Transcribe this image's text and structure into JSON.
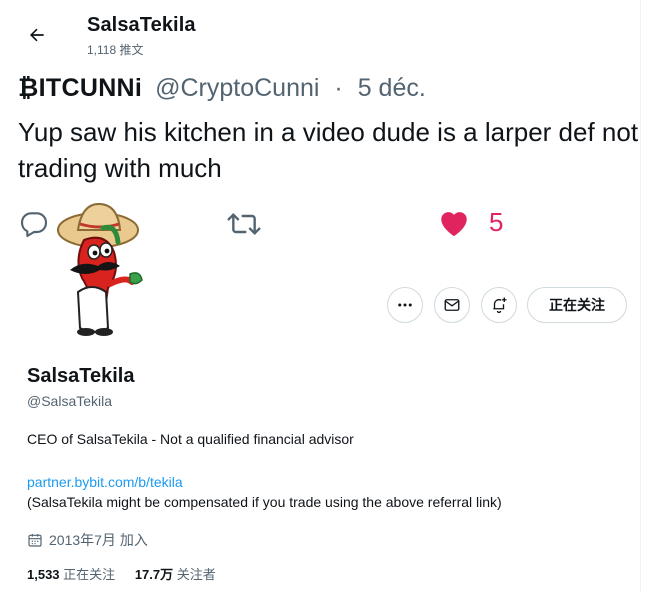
{
  "header": {
    "title": "SalsaTekila",
    "subtitle": "1,118 推文"
  },
  "tweet": {
    "author": "₿ITCUNNi",
    "handle": "@CryptoCunni",
    "separator": "·",
    "date": "5 déc.",
    "text": "Yup saw his kitchen in a video dude is a larper def not trading with much",
    "likes": "5"
  },
  "profile": {
    "name": "SalsaTekila",
    "handle": "@SalsaTekila",
    "bio": "CEO of SalsaTekila - Not a qualified financial advisor",
    "link": "partner.bybit.com/b/tekila",
    "note": "(SalsaTekila might be compensated if you trade using the above referral link)",
    "joined": "2013年7月 加入",
    "following_count": "1,533",
    "following_label": "正在关注",
    "followers_count": "17.7万",
    "followers_label": "关注者",
    "follow_button": "正在关注"
  },
  "icons": {
    "back": "arrow-left-icon",
    "reply": "reply-icon",
    "retweet": "retweet-icon",
    "like": "heart-icon",
    "more": "more-icon",
    "message": "envelope-icon",
    "notify": "bell-plus-icon",
    "calendar": "calendar-icon"
  },
  "colors": {
    "like": "#e0245e",
    "link": "#1d9bf0",
    "muted": "#536471",
    "text": "#0f1419",
    "border": "#cfd9de"
  }
}
